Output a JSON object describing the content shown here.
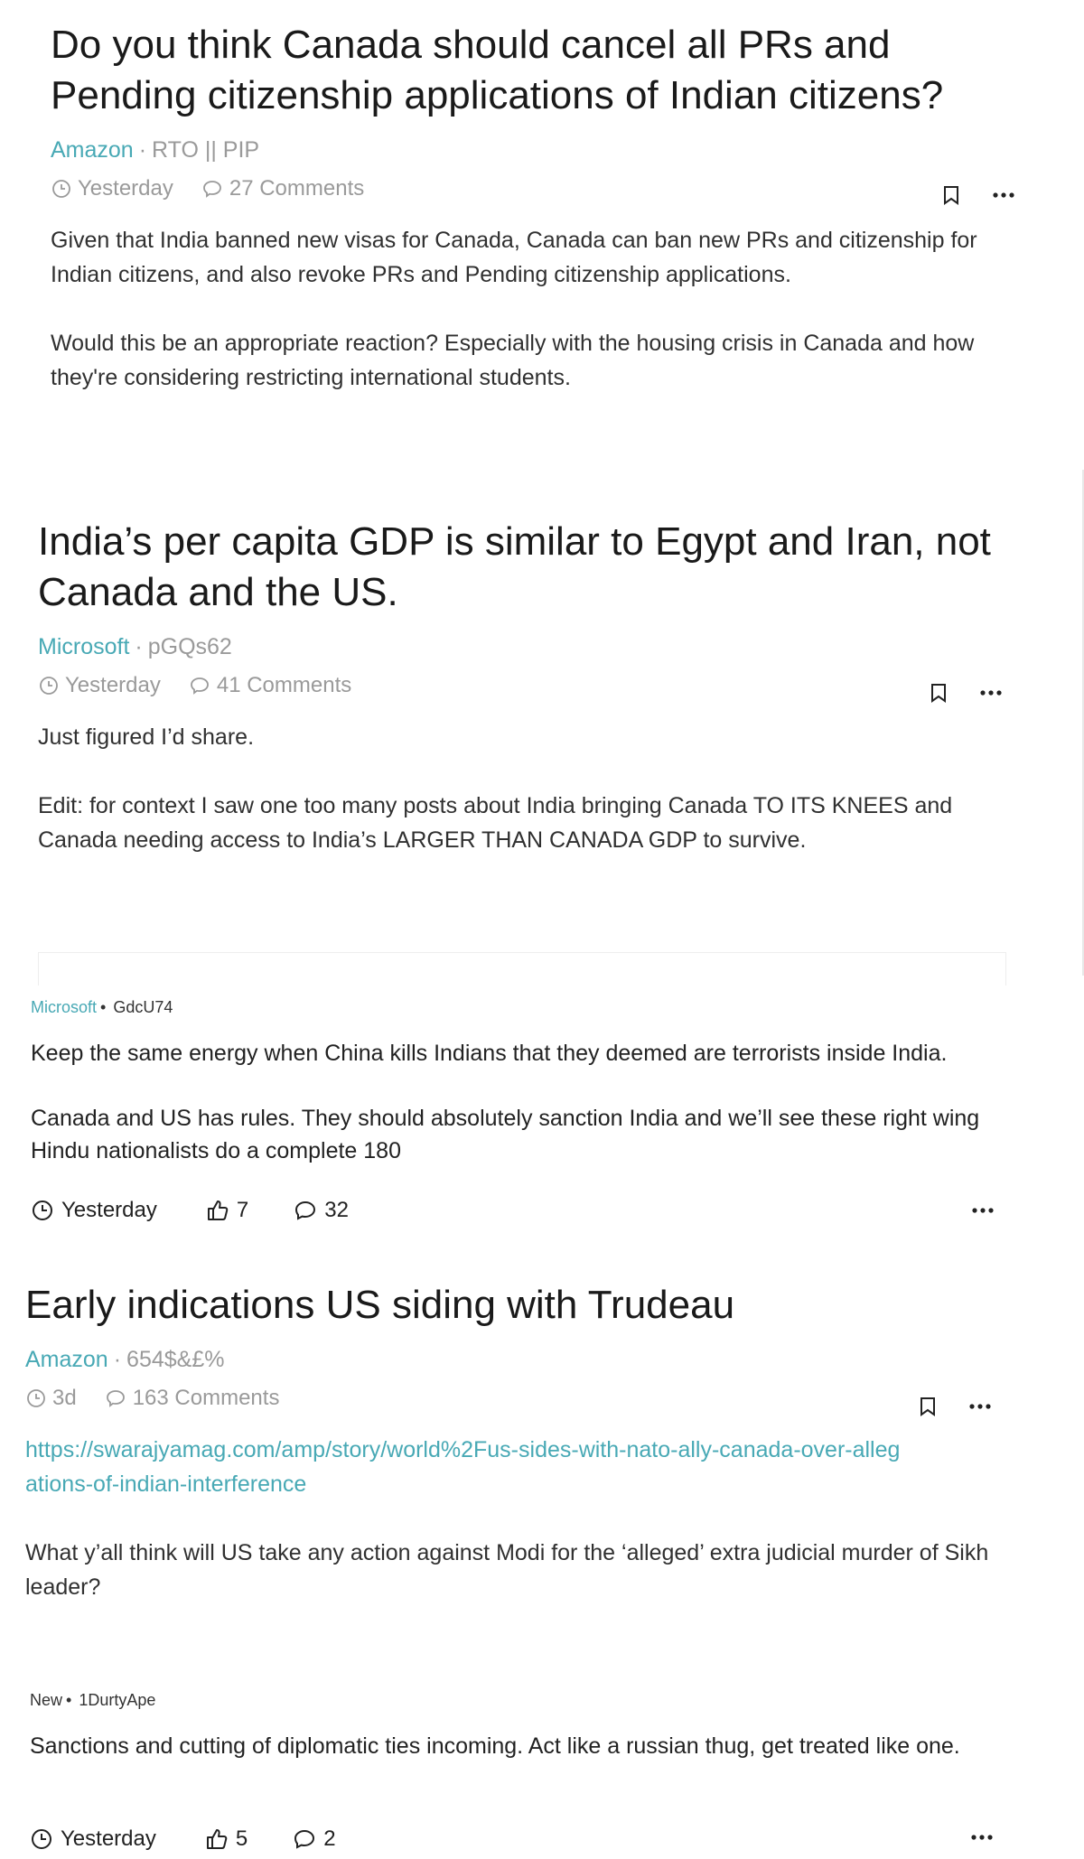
{
  "posts": [
    {
      "title": "Do you think Canada should cancel all PRs and Pending citizenship applications of Indian citizens?",
      "company": "Amazon",
      "author": "RTO || PIP",
      "time": "Yesterday",
      "comments": "27 Comments",
      "body": [
        "Given that India banned new visas for Canada, Canada can ban new PRs and citizenship for Indian citizens, and also revoke PRs and Pending citizenship applications.",
        "Would this be an appropriate reaction? Especially with the housing crisis in Canada and how they're considering restricting international students."
      ]
    },
    {
      "title": "India’s per capita GDP is similar to Egypt and Iran, not Canada and the US.",
      "company": "Microsoft",
      "author": "pGQs62",
      "time": "Yesterday",
      "comments": "41 Comments",
      "body": [
        "Just figured I’d share.",
        "Edit: for context I saw one too many posts about India bringing Canada TO ITS KNEES and Canada needing access to India’s LARGER THAN CANADA GDP to survive."
      ]
    },
    {
      "title": "Early indications US siding with Trudeau",
      "company": "Amazon",
      "author": "654$&£%",
      "time": "3d",
      "comments": "163 Comments",
      "link": "https://swarajyamag.com/amp/story/world%2Fus-sides-with-nato-ally-canada-over-allegations-of-indian-interference",
      "body": [
        "What y’all think will US take any action against Modi for the ‘alleged’ extra judicial murder of Sikh leader?"
      ]
    }
  ],
  "comments": [
    {
      "company": "Microsoft",
      "author": "GdcU74",
      "body": [
        "Keep the same energy when China kills Indians that they deemed are terrorists inside India.",
        "Canada and US has rules. They should absolutely sanction India and we’ll see these right wing Hindu nationalists do a complete 180"
      ],
      "time": "Yesterday",
      "likes": "7",
      "replies": "32"
    },
    {
      "company": "New",
      "author": "1DurtyApe",
      "body": [
        "Sanctions and cutting of diplomatic ties incoming. Act like a russian thug, get treated like one."
      ],
      "time": "Yesterday",
      "likes": "5",
      "replies": "2"
    }
  ],
  "separator": "·",
  "bullet": "•",
  "colors": {
    "accent": "#48a9b5",
    "muted": "#9a9a9a",
    "text": "#222222"
  },
  "icons": [
    "clock-icon",
    "comment-icon",
    "bookmark-icon",
    "more-icon",
    "thumbs-up-icon"
  ]
}
